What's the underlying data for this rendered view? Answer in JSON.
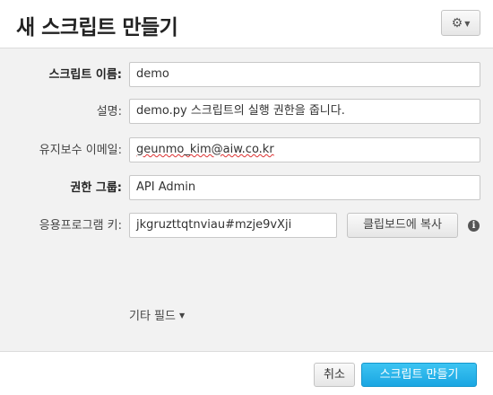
{
  "dialog": {
    "title": "새 스크립트 만들기",
    "settings_icon": "gear-icon"
  },
  "form": {
    "script_name": {
      "label": "스크립트 이름:",
      "value": "demo"
    },
    "description": {
      "label": "설명:",
      "value": "demo.py 스크립트의 실행 권한을 줍니다."
    },
    "maintainer_email": {
      "label": "유지보수 이메일:",
      "value": "geunmo_kim@aiw.co.kr"
    },
    "permission_group": {
      "label": "권한 그룹:",
      "value": "API Admin"
    },
    "app_key": {
      "label": "응용프로그램 키:",
      "value": "jkgruzttqtnviau#mzje9vXji",
      "copy_button": "클립보드에 복사",
      "info_icon": "info-icon"
    },
    "other_fields": "기타 필드"
  },
  "footer": {
    "cancel": "취소",
    "create": "스크립트 만들기"
  },
  "colors": {
    "primary": "#1aa6e2",
    "background": "#f2f2f2"
  }
}
